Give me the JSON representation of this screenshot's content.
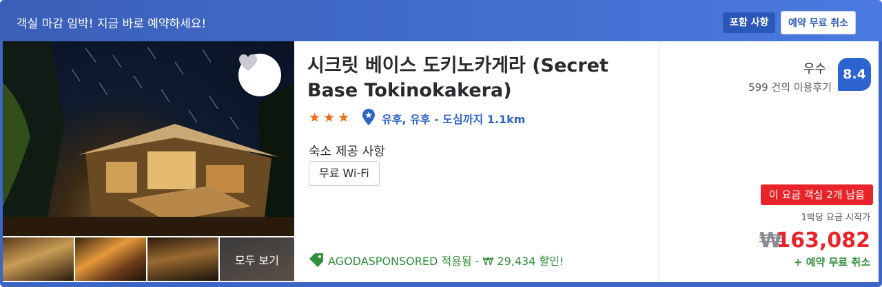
{
  "banner": {
    "text": "객실 마감 임박! 지금 바로 예약하세요!",
    "chips": {
      "included": "포함 사항",
      "free_cancel": "예약 무료 취소"
    }
  },
  "gallery": {
    "see_all": "모두 보기"
  },
  "hotel": {
    "name": "시크릿 베이스 도키노카게라 (Secret Base Tokinokakera)",
    "stars": 3,
    "location": "유후, 유후 - 도심까지 1.1km",
    "amenities_title": "숙소 제공 사항",
    "amenities": [
      "무료 Wi-Fi"
    ],
    "promo": "AGODASPONSORED 적용됨 - ₩ 29,434 할인!"
  },
  "rating": {
    "word": "우수",
    "reviews": "599 건의 이용후기",
    "score": "8.4"
  },
  "pricing": {
    "urgency": "이 요금 객실 2개 남음",
    "from_label": "1박당 요금 시작가",
    "original": "₩",
    "price": "163,082",
    "cancel": "+ 예약 무료 취소"
  },
  "colors": {
    "banner": "#3a5fb8",
    "accent_blue": "#2e64d0",
    "star": "#f36b1c",
    "price_red": "#e8242a",
    "promo_green": "#2f8f3a"
  }
}
